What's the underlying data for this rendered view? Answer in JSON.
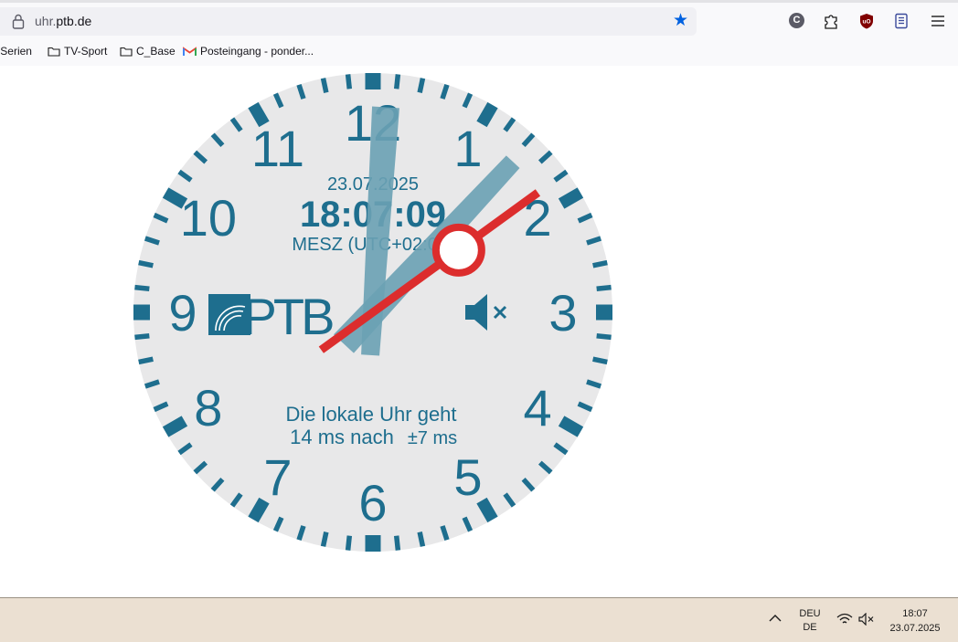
{
  "browser": {
    "url_prefix": "uhr.",
    "url_domain": "ptb.de",
    "bookmarks": [
      "'-Serien",
      "TV-Sport",
      "C_Base",
      "Posteingang - ponder..."
    ],
    "extension_c_label": "C"
  },
  "clock": {
    "date": "23.07.2025",
    "time": "18:07:09",
    "timezone": "MESZ (UTC+02:00)",
    "logo_text": "PTB",
    "offset_line1": "Die lokale Uhr geht",
    "offset_line2": "14 ms nach",
    "offset_precision": "±7 ms",
    "numerals": [
      "12",
      "1",
      "2",
      "3",
      "4",
      "5",
      "6",
      "7",
      "8",
      "9",
      "10",
      "11"
    ],
    "hour": 6,
    "minute": 7,
    "second": 9,
    "colors": {
      "face": "#e8e8e9",
      "accent": "#1e6e8e",
      "hand": "#6aa1b4",
      "second_hand": "#dc2d2d"
    },
    "sound": "muted"
  },
  "taskbar": {
    "lang_line1": "DEU",
    "lang_line2": "DE",
    "time": "18:07",
    "date": "23.07.2025"
  }
}
